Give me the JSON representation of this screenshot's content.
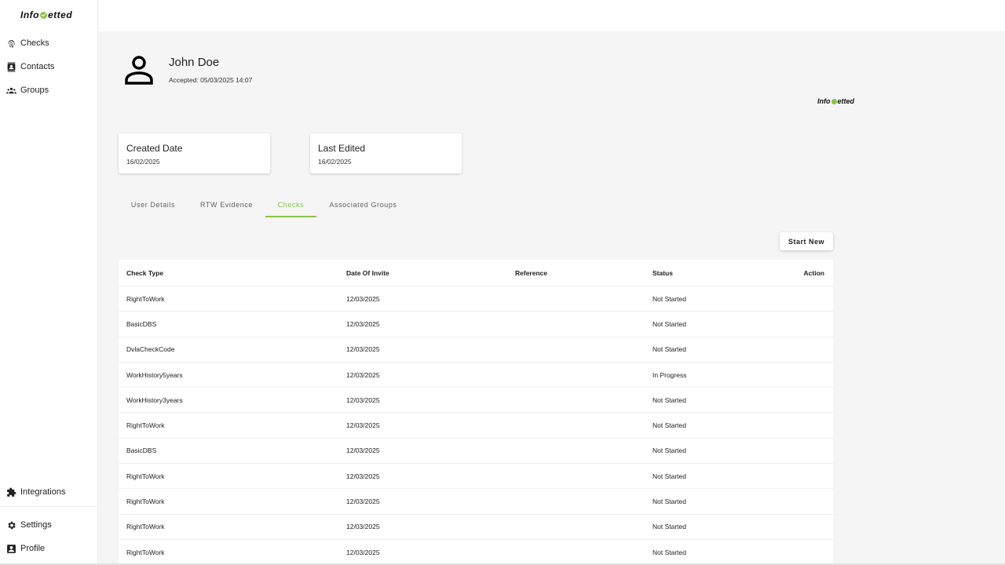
{
  "brand": {
    "prefix": "Info",
    "suffix": "etted"
  },
  "sidebar": {
    "items": [
      {
        "label": "Checks"
      },
      {
        "label": "Contacts"
      },
      {
        "label": "Groups"
      }
    ],
    "bottom_items": [
      {
        "label": "Integrations"
      },
      {
        "label": "Settings"
      },
      {
        "label": "Profile"
      }
    ]
  },
  "profile": {
    "name": "John Doe",
    "accepted": "Accepted: 05/03/2025 14:07"
  },
  "cards": [
    {
      "title": "Created Date",
      "value": "16/02/2025"
    },
    {
      "title": "Last Edited",
      "value": "16/02/2025"
    }
  ],
  "tabs": [
    {
      "label": "User Details"
    },
    {
      "label": "RTW Evidence"
    },
    {
      "label": "Checks",
      "active": true
    },
    {
      "label": "Associated Groups"
    }
  ],
  "actions": {
    "start_new": "Start New"
  },
  "table": {
    "headers": [
      "Check Type",
      "Date Of Invite",
      "Reference",
      "Status",
      "Action"
    ],
    "rows": [
      {
        "type": "RightToWork",
        "date": "12/03/2025",
        "reference": "",
        "status": "Not Started"
      },
      {
        "type": "BasicDBS",
        "date": "12/03/2025",
        "reference": "",
        "status": "Not Started"
      },
      {
        "type": "DvlaCheckCode",
        "date": "12/03/2025",
        "reference": "",
        "status": "Not Started"
      },
      {
        "type": "WorkHistory5years",
        "date": "12/03/2025",
        "reference": "",
        "status": "In Progress"
      },
      {
        "type": "WorkHistory3years",
        "date": "12/03/2025",
        "reference": "",
        "status": "Not Started"
      },
      {
        "type": "RightToWork",
        "date": "12/03/2025",
        "reference": "",
        "status": "Not Started"
      },
      {
        "type": "BasicDBS",
        "date": "12/03/2025",
        "reference": "",
        "status": "Not Started"
      },
      {
        "type": "RightToWork",
        "date": "12/03/2025",
        "reference": "",
        "status": "Not Started"
      },
      {
        "type": "RightToWork",
        "date": "12/03/2025",
        "reference": "",
        "status": "Not Started"
      },
      {
        "type": "RightToWork",
        "date": "12/03/2025",
        "reference": "",
        "status": "Not Started"
      },
      {
        "type": "RightToWork",
        "date": "12/03/2025",
        "reference": "",
        "status": "Not Started"
      }
    ]
  },
  "colors": {
    "accent": "#8bc34a",
    "background": "#f5f5f5",
    "surface": "#ffffff"
  }
}
